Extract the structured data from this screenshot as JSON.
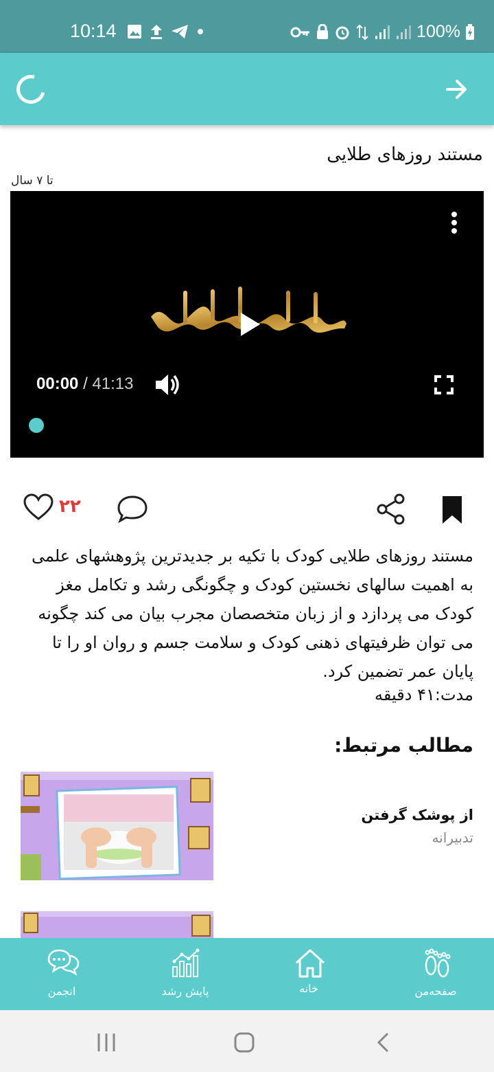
{
  "status": {
    "time": "10:14",
    "battery": "100%"
  },
  "content": {
    "title": "مستند روزهای طلایی",
    "age": "تا ۷ سال",
    "video": {
      "current": "00:00",
      "separator": "/",
      "duration": "41:13"
    },
    "likes": "۲۲",
    "description": "مستند روزهای طلایی کودک با تکیه بر جدیدترین  پژوهشهای علمی به اهمیت سالهای نخستین کودک و چگونگی رشد و تکامل مغز کودک می پردازد و از زبان متخصصان مجرب بیان می کند چگونه می توان ظرفیتهای ذهنی کودک و سلامت جسم و روان او را تا پایان عمر تضمین کرد.",
    "duration_text": "مدت:۴۱ دقیقه",
    "related_title": "مطالب مرتبط:",
    "related": [
      {
        "title": "از پوشک گرفتن",
        "category": "تدبیرانه"
      }
    ]
  },
  "bottom_nav": [
    {
      "label": "انجمن",
      "icon": "chat-bubbles-icon"
    },
    {
      "label": "پایش رشد",
      "icon": "growth-chart-icon"
    },
    {
      "label": "خانه",
      "icon": "home-icon"
    },
    {
      "label": "صفحه‌من",
      "icon": "footprints-icon"
    }
  ],
  "colors": {
    "accent": "#5ccbcb",
    "status_bar": "#4e9a9d",
    "likes": "#e03b3b"
  }
}
